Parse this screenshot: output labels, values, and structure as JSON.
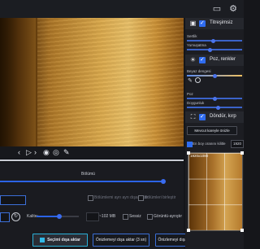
{
  "toolbar": {
    "icons": [
      "folder-icon",
      "gear-icon"
    ]
  },
  "player": {
    "icons": [
      "prev-icon",
      "play-icon",
      "next-icon",
      "eye-icon",
      "visibility-icon",
      "eyedropper-icon"
    ]
  },
  "left_panel": {
    "section_label": "Bölümü",
    "option_split": "Bölümlemi ayrı ayrı dışa aktar",
    "option_merge": "Bölümleri birleştir",
    "quality_label": "Kalite:",
    "size_value": "~102 MB",
    "silent_label": "Sessiz",
    "visible_sync_label": "Görüntü-ayrıştır"
  },
  "buttons": {
    "export_selection": "Seçimi dışa aktar",
    "export_preview_3": "Önizlemeyi dışa aktar (3 sn)",
    "export_preview_10": "Önizlemeyi dışa aktar (10 sn)"
  },
  "right_panel": {
    "denoise": {
      "title": "Titreşimsiz",
      "labels": [
        "Sertlik",
        "Yumuşatma"
      ],
      "values": [
        0.45,
        0.4
      ]
    },
    "color": {
      "title": "Poz, renkler",
      "labels": [
        "Beyaz dengesi",
        "Poz",
        "Doygunluk"
      ],
      "values": [
        0.5,
        0.5,
        0.55
      ]
    },
    "transform": {
      "title": "Döndür, kırp",
      "reset_button": "Mevcut kareyle önizle",
      "aspect_check": "En boy oranını kilitle",
      "aspect_value": "1920",
      "resolution_label": "1920x1080"
    }
  }
}
